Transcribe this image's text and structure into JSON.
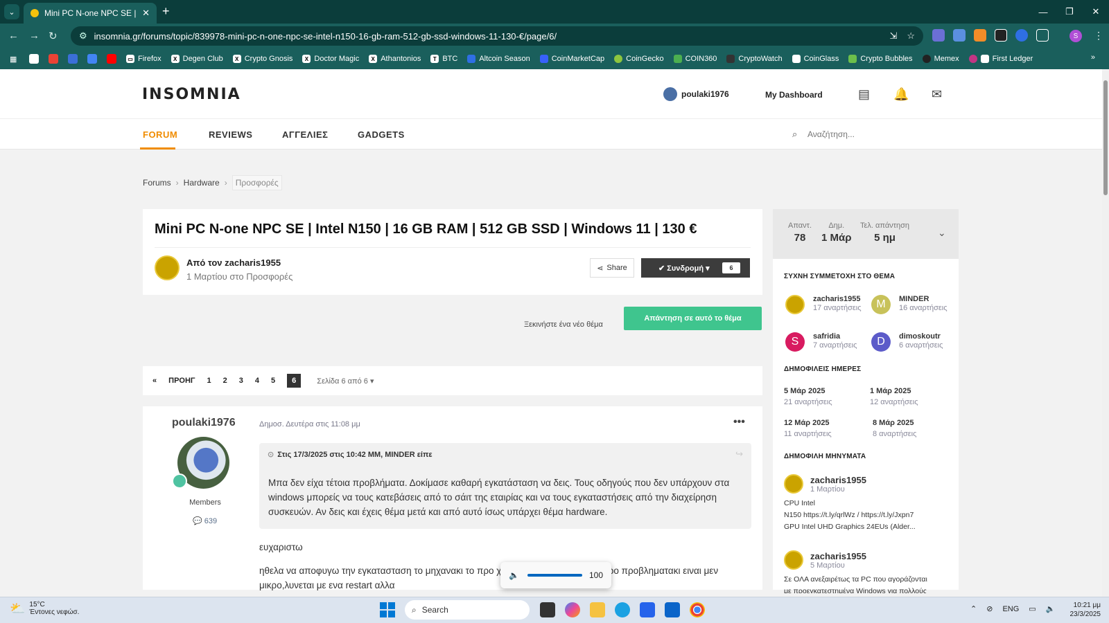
{
  "browser": {
    "tab_title": "Mini PC N-one NPC SE | Intel N",
    "url": "insomnia.gr/forums/topic/839978-mini-pc-n-one-npc-se-intel-n150-16-gb-ram-512-gb-ssd-windows-11-130-€/page/6/",
    "profile_initial": "S",
    "bookmarks": [
      "Firefox",
      "Degen Club",
      "Crypto Gnosis",
      "Doctor Magic",
      "Athantonios",
      "BTC",
      "Altcoin Season",
      "CoinMarketCap",
      "CoinGecko",
      "COIN360",
      "CryptoWatch",
      "CoinGlass",
      "Crypto Bubbles",
      "Memex",
      "First Ledger"
    ]
  },
  "site": {
    "logo": "INSOMNIA",
    "username": "poulaki1976",
    "dashboard": "My Dashboard",
    "nav": [
      "FORUM",
      "REVIEWS",
      "ΑΓΓΕΛΙΕΣ",
      "GADGETS"
    ],
    "search_placeholder": "Αναζήτηση..."
  },
  "breadcrumb": [
    "Forums",
    "Hardware",
    "Προσφορές"
  ],
  "topic": {
    "title": "Mini PC N-one NPC SE | Intel N150 | 16 GB RAM | 512 GB SSD | Windows 11 | 130 €",
    "by": "Από τον zacharis1955",
    "date": "1 Μαρτίου στο Προσφορές",
    "share": "Share",
    "subscribe": "✔ Συνδρομή ▾",
    "subscribe_count": "6",
    "new_topic": "Ξεκινήστε ένα νέο θέμα",
    "reply": "Απάντηση σε αυτό το θέμα"
  },
  "pagination": {
    "first": "«",
    "prev": "ΠΡΟΗΓ",
    "pages": [
      "1",
      "2",
      "3",
      "4",
      "5",
      "6"
    ],
    "current": "6",
    "of": "Σελίδα 6 από 6 ▾"
  },
  "post": {
    "author": "poulaki1976",
    "group": "Members",
    "posts": "💬 639",
    "date": "Δημοσ. Δευτέρα στις 11:08 μμ",
    "menu": "•••",
    "quote_head": "Στις 17/3/2025 στις 10:42 ΜΜ, MINDER είπε",
    "quote_body": "Μπα δεν είχα τέτοια προβλήματα. Δοκίμασε καθαρή εγκατάσταση να δεις. Τους οδηγούς που δεν υπάρχουν στα windows μπορείς να τους κατεβάσεις από το σάιτ της εταιρίας και να τους εγκαταστήσεις από την διαχείρηση συσκευών. Αν δεις και έχεις θέμα μετά και από αυτό ίσως υπάρχει θέμα hardware.",
    "text1": "ευχαριστω",
    "text2": "ηθελα να αποφυγω την εγκατασταση το μηχανακι το προ                                         χρειαζεται αλλα αυτο το μικρο προβληματακι ειναι μεν μικρο,λυνεται με ενα restart αλλα"
  },
  "volume": {
    "level": 100,
    "label": "100"
  },
  "sidebar": {
    "stats": [
      {
        "label": "Απαντ.",
        "value": "78"
      },
      {
        "label": "Δημ.",
        "value": "1 Μάρ"
      },
      {
        "label": "Τελ. απάντηση",
        "value": "5 ημ"
      }
    ],
    "participants_title": "ΣΥΧΝΗ ΣΥΜΜΕΤΟΧΗ ΣΤΟ ΘΕΜΑ",
    "participants": [
      {
        "name": "zacharis1955",
        "count": "17 αναρτήσεις",
        "initial": "",
        "color": "#caa300"
      },
      {
        "name": "MINDER",
        "count": "16 αναρτήσεις",
        "initial": "M",
        "color": "#c8c25a"
      },
      {
        "name": "safridia",
        "count": "7 αναρτήσεις",
        "initial": "S",
        "color": "#d81b60"
      },
      {
        "name": "dimoskoutr",
        "count": "6 αναρτήσεις",
        "initial": "D",
        "color": "#5c5bc9"
      }
    ],
    "days_title": "ΔΗΜΟΦΙΛΕΙΣ ΗΜΕΡΕΣ",
    "days": [
      {
        "date": "5 Μάρ 2025",
        "count": "21 αναρτήσεις"
      },
      {
        "date": "1 Μάρ 2025",
        "count": "12 αναρτήσεις"
      },
      {
        "date": "12 Μάρ 2025",
        "count": "11 αναρτήσεις"
      },
      {
        "date": "8 Μάρ 2025",
        "count": "8 αναρτήσεις"
      }
    ],
    "posts_title": "ΔΗΜΟΦΙΛΗ ΜΗΝΥΜΑΤΑ",
    "popular": [
      {
        "name": "zacharis1955",
        "date": "1 Μαρτίου",
        "l1": "CPU  Intel",
        "l2": "N150  https://t.ly/qrlWz  /  https://t.ly/Jxpn7",
        "l3": "GPU  Intel UHD Graphics 24EUs (Alder..."
      },
      {
        "name": "zacharis1955",
        "date": "5 Μαρτίου",
        "l1": "Σε ΟΛΑ ανεξαιρέτως τα PC που αγοράζονται",
        "l2": "με προεγκατεστημένα Windows για πολλούς",
        "l3": ""
      }
    ]
  },
  "taskbar": {
    "temp": "15°C",
    "weather": "Έντονες νεφώσ.",
    "search": "Search",
    "lang": "ENG",
    "time": "10:21 μμ",
    "date": "23/3/2025"
  }
}
